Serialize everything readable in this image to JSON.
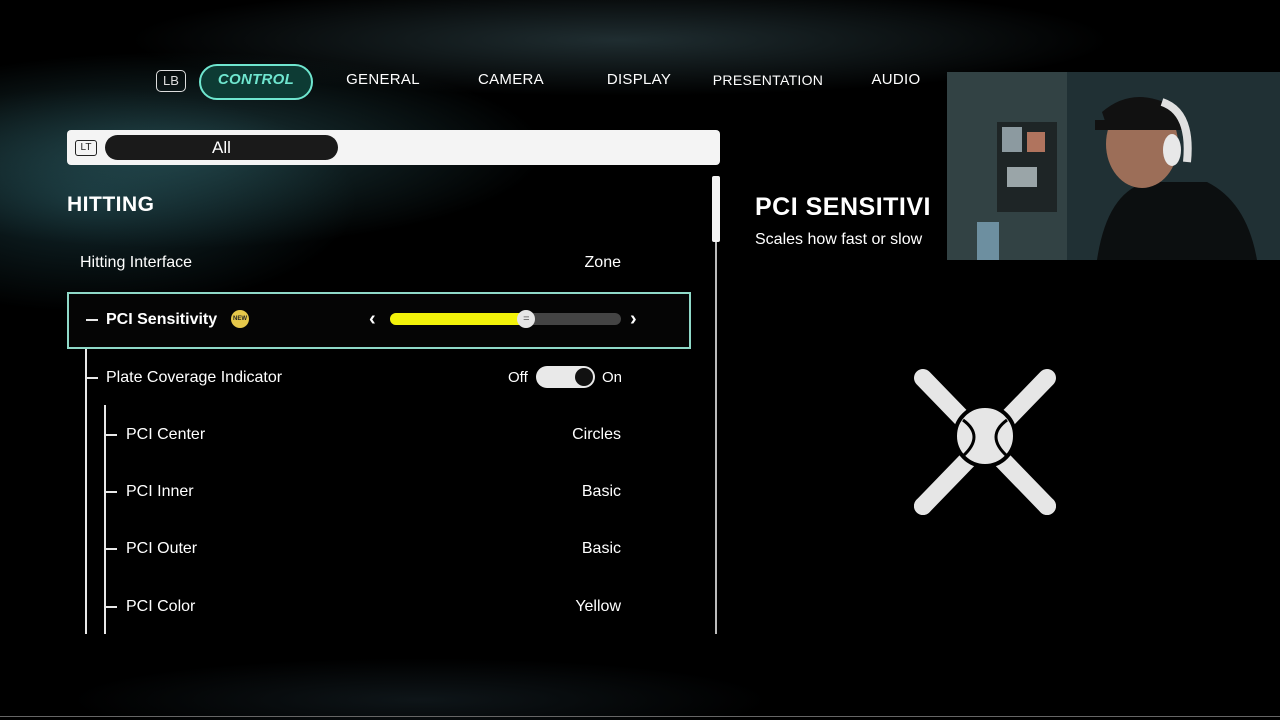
{
  "nav": {
    "left_bumper": "LB",
    "tabs": [
      {
        "label": "CONTROL",
        "active": true
      },
      {
        "label": "GENERAL",
        "active": false
      },
      {
        "label": "CAMERA",
        "active": false
      },
      {
        "label": "DISPLAY",
        "active": false
      },
      {
        "label": "PRESENTATION",
        "active": false
      },
      {
        "label": "AUDIO",
        "active": false
      }
    ]
  },
  "filter": {
    "trigger": "LT",
    "value": "All"
  },
  "section": {
    "title": "HITTING"
  },
  "settings": {
    "hitting_interface": {
      "label": "Hitting Interface",
      "value": "Zone"
    },
    "pci_sensitivity": {
      "label": "PCI Sensitivity",
      "badge": "NEW",
      "level": 0.59,
      "thumb_glyph": "="
    },
    "plate_coverage": {
      "label": "Plate Coverage Indicator",
      "off_label": "Off",
      "on_label": "On",
      "state": "on"
    },
    "pci_center": {
      "label": "PCI Center",
      "value": "Circles"
    },
    "pci_inner": {
      "label": "PCI Inner",
      "value": "Basic"
    },
    "pci_outer": {
      "label": "PCI Outer",
      "value": "Basic"
    },
    "pci_color": {
      "label": "PCI Color",
      "value": "Yellow"
    }
  },
  "detail": {
    "title": "PCI SENSITIVI",
    "description": "Scales how fast or slow"
  },
  "colors": {
    "accent": "#6fe6cf",
    "slider_fill": "#f2f20a",
    "new_badge": "#e6c84a"
  },
  "icons": {
    "left_arrow": "‹",
    "right_arrow": "›"
  }
}
